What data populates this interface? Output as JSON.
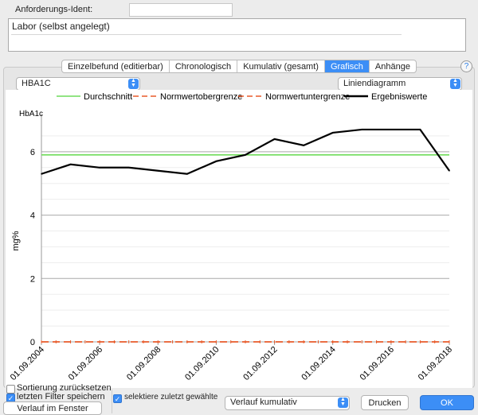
{
  "header": {
    "ident_label": "Anforderungs-Ident:",
    "ident_value": "",
    "note": "Labor (selbst angelegt)"
  },
  "tabs": [
    {
      "label": "Einzelbefund (editierbar)",
      "active": false
    },
    {
      "label": "Chronologisch",
      "active": false
    },
    {
      "label": "Kumulativ (gesamt)",
      "active": false
    },
    {
      "label": "Grafisch",
      "active": true
    },
    {
      "label": "Anhänge",
      "active": false
    }
  ],
  "help_label": "?",
  "parameter_select": {
    "value": "HBA1C"
  },
  "chart_type_select": {
    "value": "Liniendiagramm"
  },
  "chart_data": {
    "type": "line",
    "title": "HbA1c",
    "ylabel": "mg%",
    "ylim": [
      0,
      7
    ],
    "yticks": [
      0,
      2,
      4,
      6
    ],
    "grid": true,
    "legend_position": "top",
    "x_tick_labels": [
      "01.09.2004",
      "01.09.2006",
      "01.09.2008",
      "01.09.2010",
      "01.09.2012",
      "01.09.2014",
      "01.09.2016",
      "01.09.2018"
    ],
    "series": [
      {
        "name": "Durchschnitt",
        "color": "#6fdc5a",
        "style": "solid",
        "x": [
          "2004-09-01",
          "2018-09-01"
        ],
        "y": [
          5.9,
          5.9
        ]
      },
      {
        "name": "Normwertobergrenze",
        "color": "#e85a2a",
        "style": "dashed",
        "x": [
          "2004-09-01",
          "2018-09-01"
        ],
        "y": [
          0,
          0
        ]
      },
      {
        "name": "Normwertuntergrenze",
        "color": "#e85a2a",
        "style": "dashed",
        "x": [
          "2004-09-01",
          "2018-09-01"
        ],
        "y": [
          0,
          0
        ]
      },
      {
        "name": "Ergebniswerte",
        "color": "#000000",
        "style": "solid",
        "x": [
          "2004-09-01",
          "2005-09-01",
          "2006-09-01",
          "2007-09-01",
          "2008-09-01",
          "2009-09-01",
          "2010-09-01",
          "2011-09-01",
          "2012-09-01",
          "2013-09-01",
          "2014-09-01",
          "2015-09-01",
          "2016-09-01",
          "2017-09-01",
          "2018-09-01"
        ],
        "y": [
          5.3,
          5.6,
          5.5,
          5.5,
          5.4,
          5.3,
          5.7,
          5.9,
          6.4,
          6.2,
          6.6,
          6.7,
          6.7,
          6.7,
          5.4
        ]
      }
    ]
  },
  "bottom": {
    "reset_sort_label": "Sortierung zurücksetzen",
    "reset_sort_checked": false,
    "save_filter_label": "letzten Filter speichern",
    "save_filter_checked": true,
    "history_window_label": "Verlauf im Fenster",
    "select_last_label": "selektiere zuletzt gewählte",
    "select_last_checked": true,
    "history_select": "Verlauf kumulativ",
    "print_label": "Drucken",
    "ok_label": "OK"
  },
  "colors": {
    "accent": "#3c8ef6"
  }
}
